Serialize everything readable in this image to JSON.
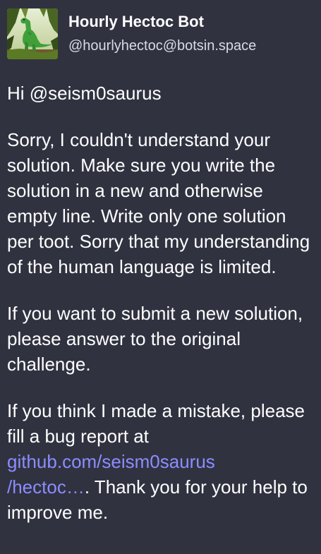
{
  "post": {
    "display_name": "Hourly Hectoc Bot",
    "handle": "@hourlyhectoc@botsin.space",
    "avatar_icon": "dinosaur-avatar",
    "greeting": "Hi @seism0saurus",
    "paragraph1": "Sorry, I couldn't understand your solution. Make sure you write the solution in a new and otherwise empty line. Write only one solution per toot. Sorry that my understanding of the human language is limited.",
    "paragraph2": "If you want to submit a new solution, please answer to the original challenge.",
    "paragraph3_prefix": "If you think I made a mistake, please fill a bug report at",
    "link_line1": "github.com/seism0saurus",
    "link_line2": "/hectoc",
    "link_ellipsis": "…",
    "paragraph3_suffix": ". Thank you for your help to improve me.",
    "colors": {
      "background": "#303240",
      "link": "#8c8dff",
      "handle": "#d9dae6"
    }
  }
}
